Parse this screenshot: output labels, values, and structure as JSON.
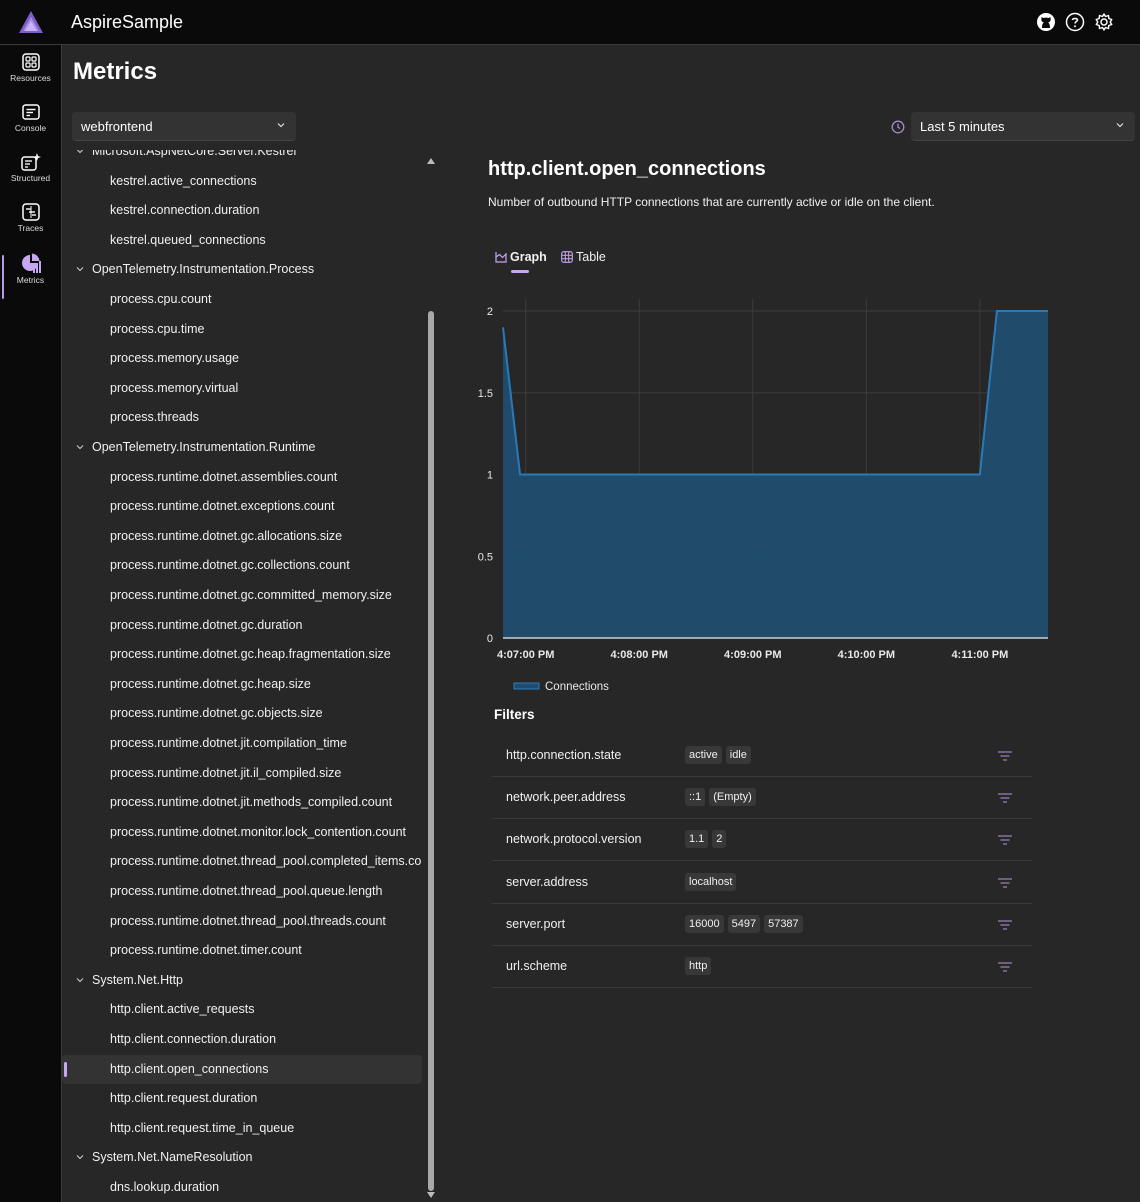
{
  "header": {
    "app_title": "AspireSample",
    "icons": [
      "github-icon",
      "help-icon",
      "settings-icon"
    ]
  },
  "nav": {
    "items": [
      {
        "label": "Resources",
        "icon": "resources-icon",
        "active": false
      },
      {
        "label": "Console",
        "icon": "console-icon",
        "active": false
      },
      {
        "label": "Structured",
        "icon": "structured-logs-icon",
        "active": false
      },
      {
        "label": "Traces",
        "icon": "traces-icon",
        "active": false
      },
      {
        "label": "Metrics",
        "icon": "metrics-icon",
        "active": true
      }
    ]
  },
  "page": {
    "title": "Metrics",
    "resource_select": {
      "value": "webfrontend"
    },
    "time_select": {
      "value": "Last 5 minutes",
      "icon": "clock-icon"
    }
  },
  "tree": {
    "rows": [
      {
        "type": "group",
        "label": "Microsoft.AspNetCore.Server.Kestrel"
      },
      {
        "type": "leaf",
        "label": "kestrel.active_connections"
      },
      {
        "type": "leaf",
        "label": "kestrel.connection.duration"
      },
      {
        "type": "leaf",
        "label": "kestrel.queued_connections"
      },
      {
        "type": "group",
        "label": "OpenTelemetry.Instrumentation.Process"
      },
      {
        "type": "leaf",
        "label": "process.cpu.count"
      },
      {
        "type": "leaf",
        "label": "process.cpu.time"
      },
      {
        "type": "leaf",
        "label": "process.memory.usage"
      },
      {
        "type": "leaf",
        "label": "process.memory.virtual"
      },
      {
        "type": "leaf",
        "label": "process.threads"
      },
      {
        "type": "group",
        "label": "OpenTelemetry.Instrumentation.Runtime"
      },
      {
        "type": "leaf",
        "label": "process.runtime.dotnet.assemblies.count"
      },
      {
        "type": "leaf",
        "label": "process.runtime.dotnet.exceptions.count"
      },
      {
        "type": "leaf",
        "label": "process.runtime.dotnet.gc.allocations.size"
      },
      {
        "type": "leaf",
        "label": "process.runtime.dotnet.gc.collections.count"
      },
      {
        "type": "leaf",
        "label": "process.runtime.dotnet.gc.committed_memory.size"
      },
      {
        "type": "leaf",
        "label": "process.runtime.dotnet.gc.duration"
      },
      {
        "type": "leaf",
        "label": "process.runtime.dotnet.gc.heap.fragmentation.size"
      },
      {
        "type": "leaf",
        "label": "process.runtime.dotnet.gc.heap.size"
      },
      {
        "type": "leaf",
        "label": "process.runtime.dotnet.gc.objects.size"
      },
      {
        "type": "leaf",
        "label": "process.runtime.dotnet.jit.compilation_time"
      },
      {
        "type": "leaf",
        "label": "process.runtime.dotnet.jit.il_compiled.size"
      },
      {
        "type": "leaf",
        "label": "process.runtime.dotnet.jit.methods_compiled.count"
      },
      {
        "type": "leaf",
        "label": "process.runtime.dotnet.monitor.lock_contention.count"
      },
      {
        "type": "leaf",
        "label": "process.runtime.dotnet.thread_pool.completed_items.count"
      },
      {
        "type": "leaf",
        "label": "process.runtime.dotnet.thread_pool.queue.length"
      },
      {
        "type": "leaf",
        "label": "process.runtime.dotnet.thread_pool.threads.count"
      },
      {
        "type": "leaf",
        "label": "process.runtime.dotnet.timer.count"
      },
      {
        "type": "group",
        "label": "System.Net.Http"
      },
      {
        "type": "leaf",
        "label": "http.client.active_requests"
      },
      {
        "type": "leaf",
        "label": "http.client.connection.duration"
      },
      {
        "type": "leaf",
        "label": "http.client.open_connections",
        "selected": true
      },
      {
        "type": "leaf",
        "label": "http.client.request.duration"
      },
      {
        "type": "leaf",
        "label": "http.client.request.time_in_queue"
      },
      {
        "type": "group",
        "label": "System.Net.NameResolution"
      },
      {
        "type": "leaf",
        "label": "dns.lookup.duration"
      }
    ]
  },
  "detail": {
    "title": "http.client.open_connections",
    "description": "Number of outbound HTTP connections that are currently active or idle on the client.",
    "tabs": [
      {
        "label": "Graph",
        "icon": "chart-icon",
        "active": true
      },
      {
        "label": "Table",
        "icon": "table-icon",
        "active": false
      }
    ],
    "filters_title": "Filters",
    "filters": [
      {
        "name": "http.connection.state",
        "values": [
          "active",
          "idle"
        ]
      },
      {
        "name": "network.peer.address",
        "values": [
          "::1",
          "(Empty)"
        ]
      },
      {
        "name": "network.protocol.version",
        "values": [
          "1.1",
          "2"
        ]
      },
      {
        "name": "server.address",
        "values": [
          "localhost"
        ]
      },
      {
        "name": "server.port",
        "values": [
          "16000",
          "5497",
          "57387"
        ]
      },
      {
        "name": "url.scheme",
        "values": [
          "http"
        ]
      }
    ]
  },
  "colors": {
    "accent": "#c7a6f2",
    "series": "#2a7ab8",
    "series_fill": "#204d6f"
  },
  "chart_data": {
    "type": "area",
    "title": "",
    "xlabel": "",
    "ylabel": "",
    "x_unit": "minutes after 4:07:00 PM",
    "x_range": [
      -0.2,
      4.6
    ],
    "ylim": [
      0,
      2
    ],
    "yticks": [
      0,
      0.5,
      1,
      1.5,
      2
    ],
    "ytick_labels": [
      "0",
      "0.5",
      "1",
      "1.5",
      "2"
    ],
    "xticks": [
      0,
      1,
      2,
      3,
      4
    ],
    "xtick_labels": [
      "4:07:00 PM",
      "4:08:00 PM",
      "4:09:00 PM",
      "4:10:00 PM",
      "4:11:00 PM"
    ],
    "grid": true,
    "legend": "bottom-left",
    "series": [
      {
        "name": "Connections",
        "x": [
          -0.2,
          -0.05,
          4.0,
          4.15,
          4.6
        ],
        "values": [
          1.9,
          1,
          1,
          2,
          2
        ]
      }
    ]
  }
}
